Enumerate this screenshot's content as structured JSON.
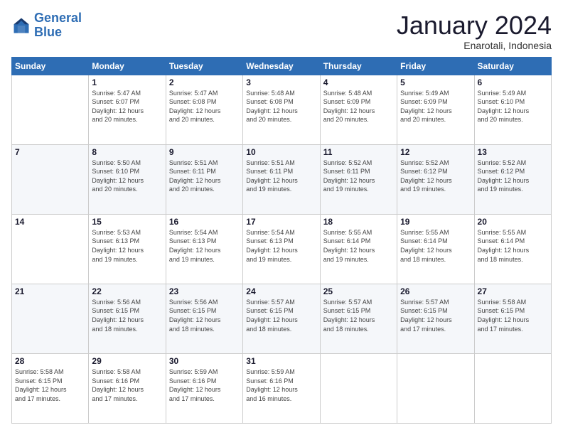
{
  "logo": {
    "line1": "General",
    "line2": "Blue"
  },
  "header": {
    "month": "January 2024",
    "location": "Enarotali, Indonesia"
  },
  "weekdays": [
    "Sunday",
    "Monday",
    "Tuesday",
    "Wednesday",
    "Thursday",
    "Friday",
    "Saturday"
  ],
  "weeks": [
    [
      {
        "day": "",
        "info": ""
      },
      {
        "day": "1",
        "info": "Sunrise: 5:47 AM\nSunset: 6:07 PM\nDaylight: 12 hours\nand 20 minutes."
      },
      {
        "day": "2",
        "info": "Sunrise: 5:47 AM\nSunset: 6:08 PM\nDaylight: 12 hours\nand 20 minutes."
      },
      {
        "day": "3",
        "info": "Sunrise: 5:48 AM\nSunset: 6:08 PM\nDaylight: 12 hours\nand 20 minutes."
      },
      {
        "day": "4",
        "info": "Sunrise: 5:48 AM\nSunset: 6:09 PM\nDaylight: 12 hours\nand 20 minutes."
      },
      {
        "day": "5",
        "info": "Sunrise: 5:49 AM\nSunset: 6:09 PM\nDaylight: 12 hours\nand 20 minutes."
      },
      {
        "day": "6",
        "info": "Sunrise: 5:49 AM\nSunset: 6:10 PM\nDaylight: 12 hours\nand 20 minutes."
      }
    ],
    [
      {
        "day": "7",
        "info": ""
      },
      {
        "day": "8",
        "info": "Sunrise: 5:50 AM\nSunset: 6:10 PM\nDaylight: 12 hours\nand 20 minutes."
      },
      {
        "day": "9",
        "info": "Sunrise: 5:51 AM\nSunset: 6:11 PM\nDaylight: 12 hours\nand 20 minutes."
      },
      {
        "day": "10",
        "info": "Sunrise: 5:51 AM\nSunset: 6:11 PM\nDaylight: 12 hours\nand 19 minutes."
      },
      {
        "day": "11",
        "info": "Sunrise: 5:52 AM\nSunset: 6:11 PM\nDaylight: 12 hours\nand 19 minutes."
      },
      {
        "day": "12",
        "info": "Sunrise: 5:52 AM\nSunset: 6:12 PM\nDaylight: 12 hours\nand 19 minutes."
      },
      {
        "day": "13",
        "info": "Sunrise: 5:52 AM\nSunset: 6:12 PM\nDaylight: 12 hours\nand 19 minutes."
      }
    ],
    [
      {
        "day": "14",
        "info": ""
      },
      {
        "day": "15",
        "info": "Sunrise: 5:53 AM\nSunset: 6:13 PM\nDaylight: 12 hours\nand 19 minutes."
      },
      {
        "day": "16",
        "info": "Sunrise: 5:54 AM\nSunset: 6:13 PM\nDaylight: 12 hours\nand 19 minutes."
      },
      {
        "day": "17",
        "info": "Sunrise: 5:54 AM\nSunset: 6:13 PM\nDaylight: 12 hours\nand 19 minutes."
      },
      {
        "day": "18",
        "info": "Sunrise: 5:55 AM\nSunset: 6:14 PM\nDaylight: 12 hours\nand 19 minutes."
      },
      {
        "day": "19",
        "info": "Sunrise: 5:55 AM\nSunset: 6:14 PM\nDaylight: 12 hours\nand 18 minutes."
      },
      {
        "day": "20",
        "info": "Sunrise: 5:55 AM\nSunset: 6:14 PM\nDaylight: 12 hours\nand 18 minutes."
      }
    ],
    [
      {
        "day": "21",
        "info": ""
      },
      {
        "day": "22",
        "info": "Sunrise: 5:56 AM\nSunset: 6:15 PM\nDaylight: 12 hours\nand 18 minutes."
      },
      {
        "day": "23",
        "info": "Sunrise: 5:56 AM\nSunset: 6:15 PM\nDaylight: 12 hours\nand 18 minutes."
      },
      {
        "day": "24",
        "info": "Sunrise: 5:57 AM\nSunset: 6:15 PM\nDaylight: 12 hours\nand 18 minutes."
      },
      {
        "day": "25",
        "info": "Sunrise: 5:57 AM\nSunset: 6:15 PM\nDaylight: 12 hours\nand 18 minutes."
      },
      {
        "day": "26",
        "info": "Sunrise: 5:57 AM\nSunset: 6:15 PM\nDaylight: 12 hours\nand 17 minutes."
      },
      {
        "day": "27",
        "info": "Sunrise: 5:58 AM\nSunset: 6:15 PM\nDaylight: 12 hours\nand 17 minutes."
      }
    ],
    [
      {
        "day": "28",
        "info": "Sunrise: 5:58 AM\nSunset: 6:15 PM\nDaylight: 12 hours\nand 17 minutes."
      },
      {
        "day": "29",
        "info": "Sunrise: 5:58 AM\nSunset: 6:16 PM\nDaylight: 12 hours\nand 17 minutes."
      },
      {
        "day": "30",
        "info": "Sunrise: 5:59 AM\nSunset: 6:16 PM\nDaylight: 12 hours\nand 17 minutes."
      },
      {
        "day": "31",
        "info": "Sunrise: 5:59 AM\nSunset: 6:16 PM\nDaylight: 12 hours\nand 16 minutes."
      },
      {
        "day": "",
        "info": ""
      },
      {
        "day": "",
        "info": ""
      },
      {
        "day": "",
        "info": ""
      }
    ]
  ]
}
